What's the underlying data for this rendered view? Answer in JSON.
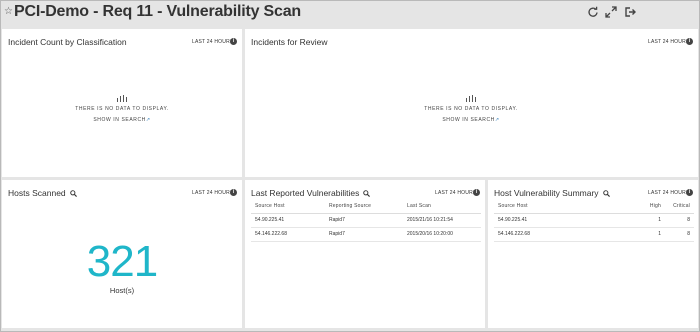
{
  "header": {
    "title": "PCI-Demo - Req 11 - Vulnerability Scan"
  },
  "panels": {
    "incident_count": {
      "title": "Incident Count by Classification",
      "time_range": "LAST 24 HOURS",
      "no_data": "THERE IS NO DATA TO DISPLAY.",
      "search_link": "SHOW IN SEARCH"
    },
    "incidents_review": {
      "title": "Incidents for Review",
      "time_range": "LAST 24 HOURS",
      "no_data": "THERE IS NO DATA TO DISPLAY.",
      "search_link": "SHOW IN SEARCH"
    },
    "hosts_scanned": {
      "title": "Hosts Scanned",
      "time_range": "LAST 24 HOURS",
      "value": "321",
      "unit": "Host(s)"
    },
    "last_vulns": {
      "title": "Last Reported Vulnerabilities",
      "time_range": "LAST 24 HOURS",
      "columns": [
        "Source Host",
        "Reporting Source",
        "Last Scan"
      ],
      "rows": [
        [
          "54.90.225.41",
          "Rapid7",
          "2015/21/16 10:21:54"
        ],
        [
          "54.146.222.68",
          "Rapid7",
          "2015/20/16 10:20:00"
        ]
      ]
    },
    "host_vuln_summary": {
      "title": "Host Vulnerability Summary",
      "time_range": "LAST 24 HOURS",
      "columns": [
        "Source Host",
        "High",
        "Critical"
      ],
      "rows": [
        [
          "54.90.225.41",
          "1",
          "8"
        ],
        [
          "54.146.222.68",
          "1",
          "8"
        ]
      ]
    }
  },
  "colors": {
    "accent": "#1fb6c9",
    "link": "#2a7ab8",
    "background": "#e5e5e5"
  }
}
